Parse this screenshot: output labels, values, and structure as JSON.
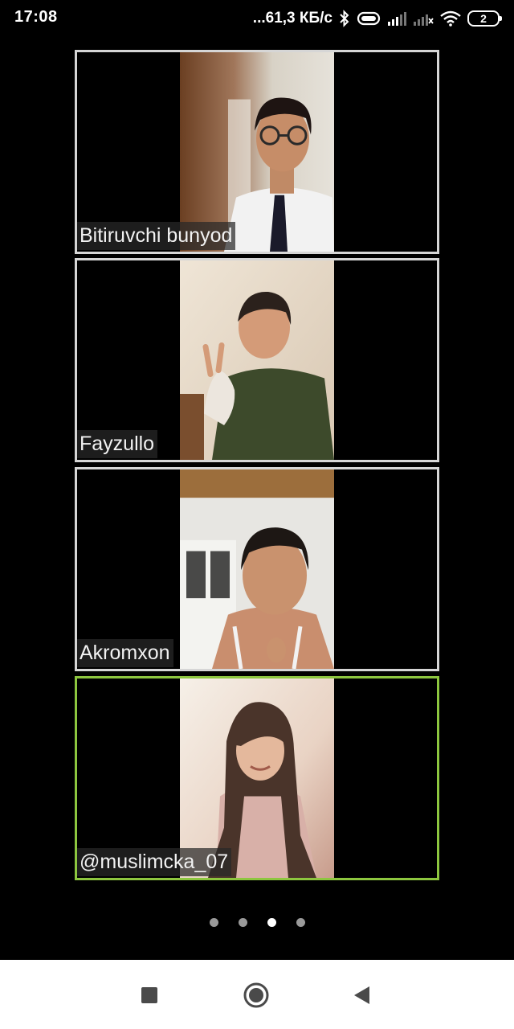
{
  "status_bar": {
    "time": "17:08",
    "net_speed": "...61,3 КБ/с",
    "battery": "2",
    "icons": [
      "bluetooth-icon",
      "vibrate-icon",
      "signal-icon",
      "signal-nodata-icon",
      "wifi-icon",
      "battery-icon"
    ]
  },
  "participants": [
    {
      "name": "Bitiruvchi bunyod",
      "active": false
    },
    {
      "name": "Fayzullo",
      "active": false
    },
    {
      "name": "Akromxon",
      "active": false
    },
    {
      "name": "@muslimcka_07",
      "active": true
    }
  ],
  "pagination": {
    "total": 4,
    "current": 3
  },
  "nav_bar": {
    "icons": [
      "recents-square-icon",
      "home-circle-icon",
      "back-triangle-icon"
    ]
  },
  "colors": {
    "background": "#000000",
    "tile_border": "#d6d6d6",
    "active_speaker_border": "#8dc63f",
    "nav_background": "#ffffff"
  }
}
